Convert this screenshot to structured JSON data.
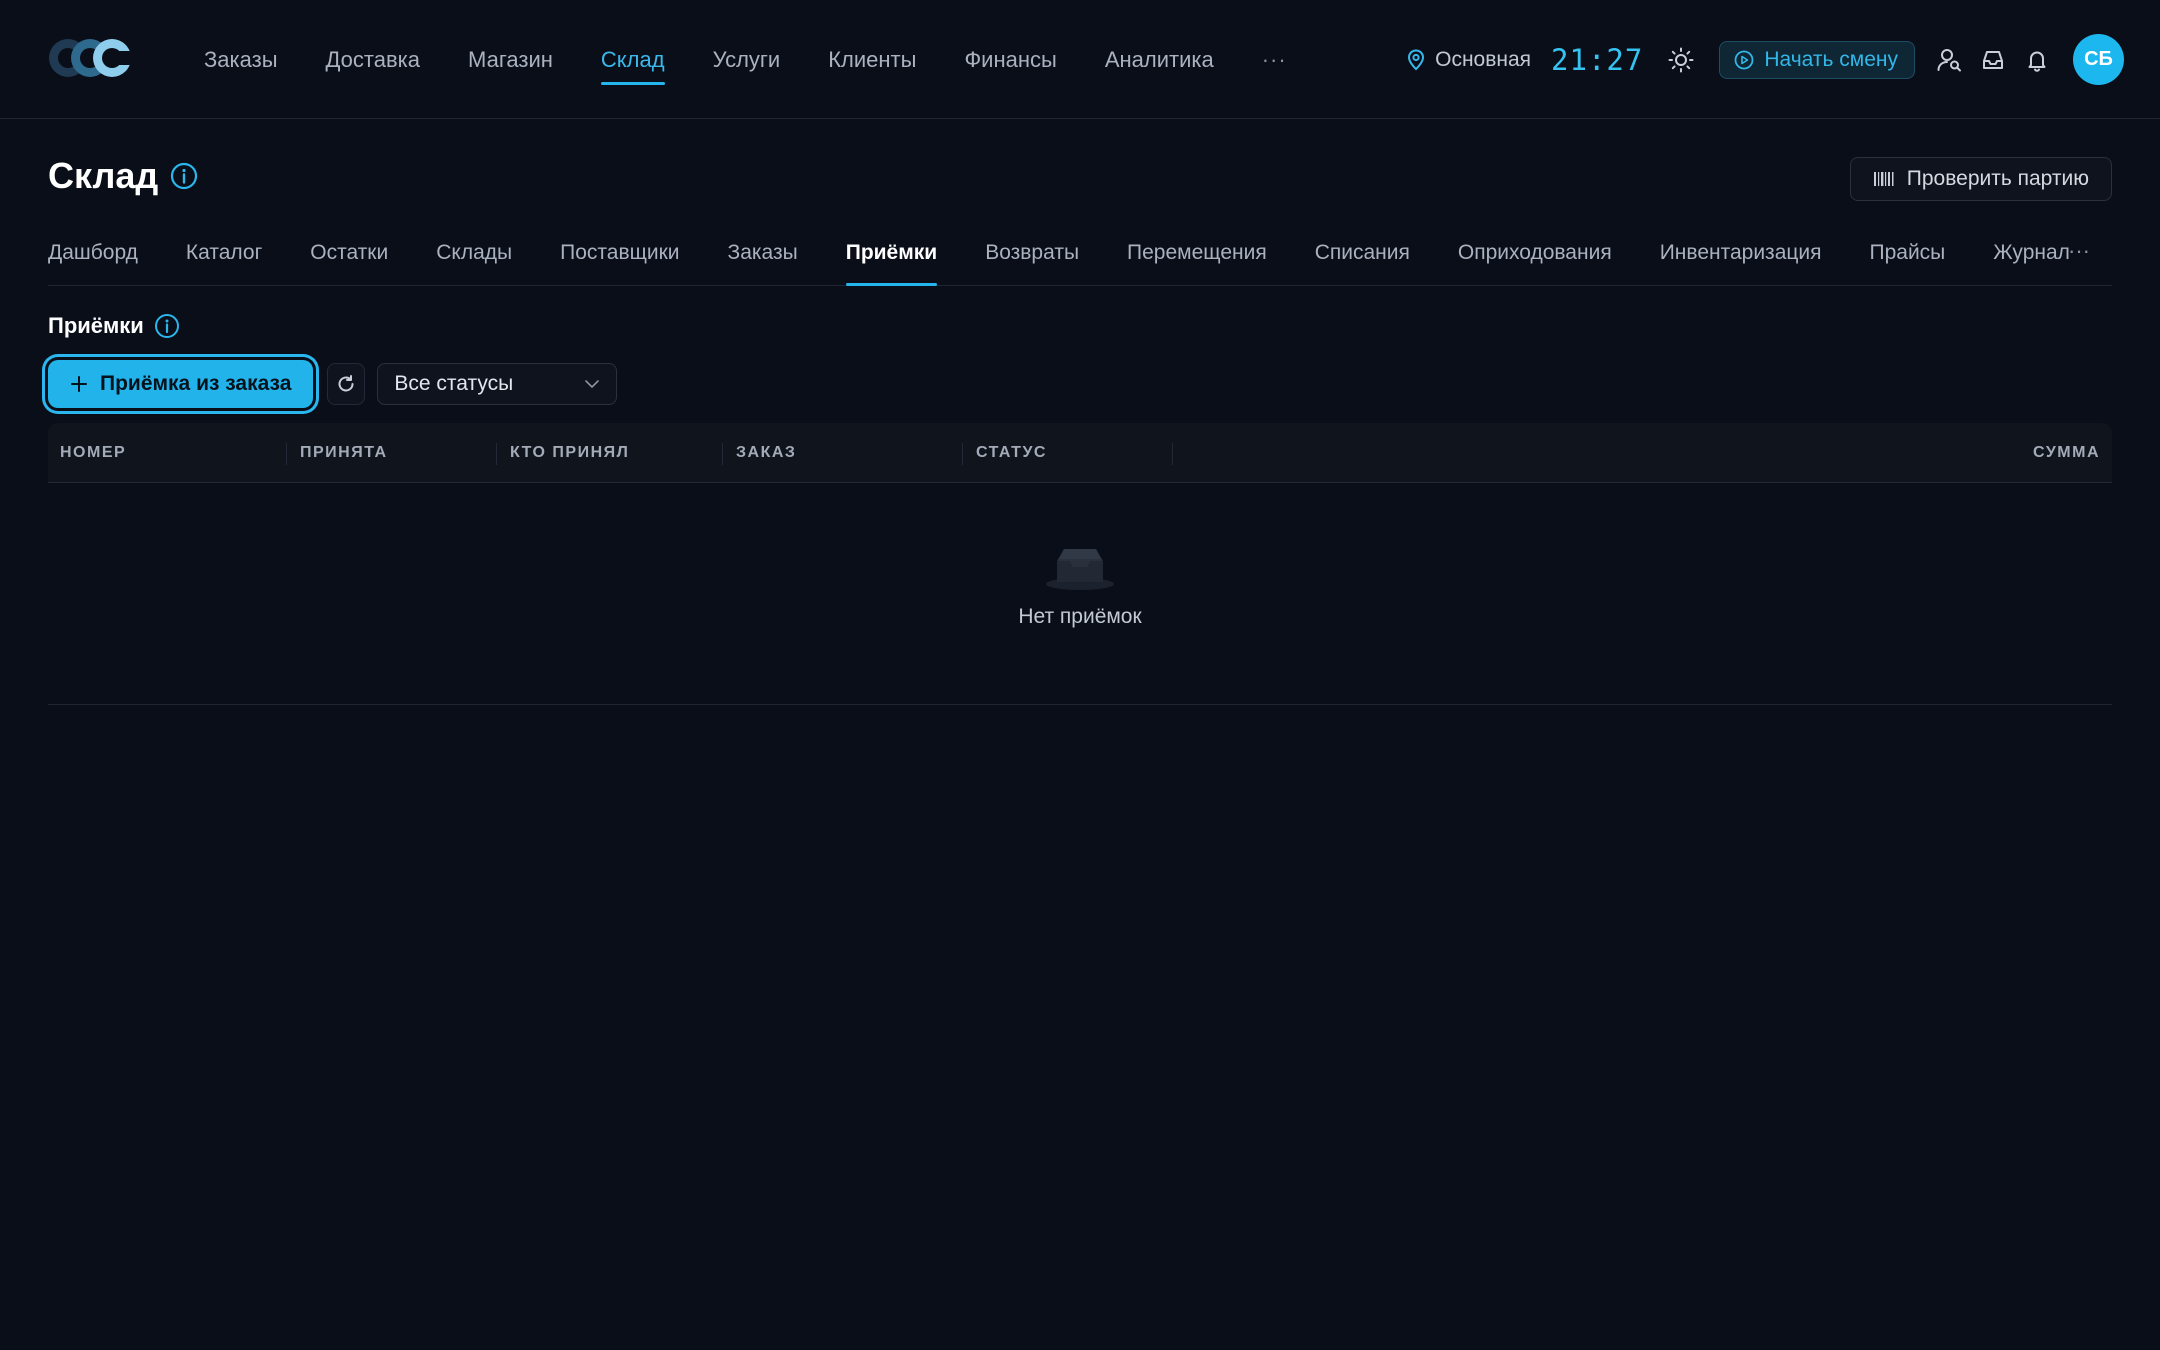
{
  "topbar": {
    "nav": [
      "Заказы",
      "Доставка",
      "Магазин",
      "Склад",
      "Услуги",
      "Клиенты",
      "Финансы",
      "Аналитика"
    ],
    "active_nav": "Склад",
    "more": "···",
    "location": "Основная",
    "clock": "21:27",
    "shift_button": "Начать смену",
    "avatar_initials": "СБ"
  },
  "page": {
    "title": "Склад",
    "check_batch_button": "Проверить партию"
  },
  "subnav": {
    "tabs": [
      "Дашборд",
      "Каталог",
      "Остатки",
      "Склады",
      "Поставщики",
      "Заказы",
      "Приёмки",
      "Возвраты",
      "Перемещения",
      "Списания",
      "Оприходования",
      "Инвентаризация",
      "Прайсы",
      "Журнал"
    ],
    "active_tab": "Приёмки",
    "more": "···"
  },
  "section": {
    "title": "Приёмки",
    "add_button": "Приёмка из заказа",
    "status_filter": "Все статусы"
  },
  "table": {
    "columns": [
      "НОМЕР",
      "ПРИНЯТА",
      "КТО ПРИНЯЛ",
      "ЗАКАЗ",
      "СТАТУС",
      "СУММА"
    ],
    "rows": [],
    "empty_text": "Нет приёмок"
  },
  "colors": {
    "background": "#0a0e18",
    "accent": "#22b3eb",
    "text_primary": "#ffffff",
    "text_secondary": "#aab1bf"
  }
}
